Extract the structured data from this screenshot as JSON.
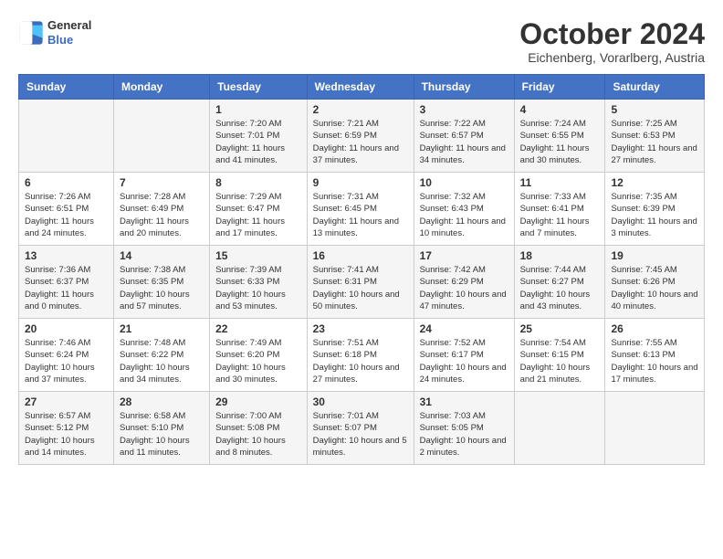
{
  "logo": {
    "general": "General",
    "blue": "Blue"
  },
  "title": "October 2024",
  "location": "Eichenberg, Vorarlberg, Austria",
  "days": [
    "Sunday",
    "Monday",
    "Tuesday",
    "Wednesday",
    "Thursday",
    "Friday",
    "Saturday"
  ],
  "weeks": [
    [
      {
        "day": "",
        "content": ""
      },
      {
        "day": "",
        "content": ""
      },
      {
        "day": "1",
        "content": "Sunrise: 7:20 AM\nSunset: 7:01 PM\nDaylight: 11 hours and 41 minutes."
      },
      {
        "day": "2",
        "content": "Sunrise: 7:21 AM\nSunset: 6:59 PM\nDaylight: 11 hours and 37 minutes."
      },
      {
        "day": "3",
        "content": "Sunrise: 7:22 AM\nSunset: 6:57 PM\nDaylight: 11 hours and 34 minutes."
      },
      {
        "day": "4",
        "content": "Sunrise: 7:24 AM\nSunset: 6:55 PM\nDaylight: 11 hours and 30 minutes."
      },
      {
        "day": "5",
        "content": "Sunrise: 7:25 AM\nSunset: 6:53 PM\nDaylight: 11 hours and 27 minutes."
      }
    ],
    [
      {
        "day": "6",
        "content": "Sunrise: 7:26 AM\nSunset: 6:51 PM\nDaylight: 11 hours and 24 minutes."
      },
      {
        "day": "7",
        "content": "Sunrise: 7:28 AM\nSunset: 6:49 PM\nDaylight: 11 hours and 20 minutes."
      },
      {
        "day": "8",
        "content": "Sunrise: 7:29 AM\nSunset: 6:47 PM\nDaylight: 11 hours and 17 minutes."
      },
      {
        "day": "9",
        "content": "Sunrise: 7:31 AM\nSunset: 6:45 PM\nDaylight: 11 hours and 13 minutes."
      },
      {
        "day": "10",
        "content": "Sunrise: 7:32 AM\nSunset: 6:43 PM\nDaylight: 11 hours and 10 minutes."
      },
      {
        "day": "11",
        "content": "Sunrise: 7:33 AM\nSunset: 6:41 PM\nDaylight: 11 hours and 7 minutes."
      },
      {
        "day": "12",
        "content": "Sunrise: 7:35 AM\nSunset: 6:39 PM\nDaylight: 11 hours and 3 minutes."
      }
    ],
    [
      {
        "day": "13",
        "content": "Sunrise: 7:36 AM\nSunset: 6:37 PM\nDaylight: 11 hours and 0 minutes."
      },
      {
        "day": "14",
        "content": "Sunrise: 7:38 AM\nSunset: 6:35 PM\nDaylight: 10 hours and 57 minutes."
      },
      {
        "day": "15",
        "content": "Sunrise: 7:39 AM\nSunset: 6:33 PM\nDaylight: 10 hours and 53 minutes."
      },
      {
        "day": "16",
        "content": "Sunrise: 7:41 AM\nSunset: 6:31 PM\nDaylight: 10 hours and 50 minutes."
      },
      {
        "day": "17",
        "content": "Sunrise: 7:42 AM\nSunset: 6:29 PM\nDaylight: 10 hours and 47 minutes."
      },
      {
        "day": "18",
        "content": "Sunrise: 7:44 AM\nSunset: 6:27 PM\nDaylight: 10 hours and 43 minutes."
      },
      {
        "day": "19",
        "content": "Sunrise: 7:45 AM\nSunset: 6:26 PM\nDaylight: 10 hours and 40 minutes."
      }
    ],
    [
      {
        "day": "20",
        "content": "Sunrise: 7:46 AM\nSunset: 6:24 PM\nDaylight: 10 hours and 37 minutes."
      },
      {
        "day": "21",
        "content": "Sunrise: 7:48 AM\nSunset: 6:22 PM\nDaylight: 10 hours and 34 minutes."
      },
      {
        "day": "22",
        "content": "Sunrise: 7:49 AM\nSunset: 6:20 PM\nDaylight: 10 hours and 30 minutes."
      },
      {
        "day": "23",
        "content": "Sunrise: 7:51 AM\nSunset: 6:18 PM\nDaylight: 10 hours and 27 minutes."
      },
      {
        "day": "24",
        "content": "Sunrise: 7:52 AM\nSunset: 6:17 PM\nDaylight: 10 hours and 24 minutes."
      },
      {
        "day": "25",
        "content": "Sunrise: 7:54 AM\nSunset: 6:15 PM\nDaylight: 10 hours and 21 minutes."
      },
      {
        "day": "26",
        "content": "Sunrise: 7:55 AM\nSunset: 6:13 PM\nDaylight: 10 hours and 17 minutes."
      }
    ],
    [
      {
        "day": "27",
        "content": "Sunrise: 6:57 AM\nSunset: 5:12 PM\nDaylight: 10 hours and 14 minutes."
      },
      {
        "day": "28",
        "content": "Sunrise: 6:58 AM\nSunset: 5:10 PM\nDaylight: 10 hours and 11 minutes."
      },
      {
        "day": "29",
        "content": "Sunrise: 7:00 AM\nSunset: 5:08 PM\nDaylight: 10 hours and 8 minutes."
      },
      {
        "day": "30",
        "content": "Sunrise: 7:01 AM\nSunset: 5:07 PM\nDaylight: 10 hours and 5 minutes."
      },
      {
        "day": "31",
        "content": "Sunrise: 7:03 AM\nSunset: 5:05 PM\nDaylight: 10 hours and 2 minutes."
      },
      {
        "day": "",
        "content": ""
      },
      {
        "day": "",
        "content": ""
      }
    ]
  ]
}
